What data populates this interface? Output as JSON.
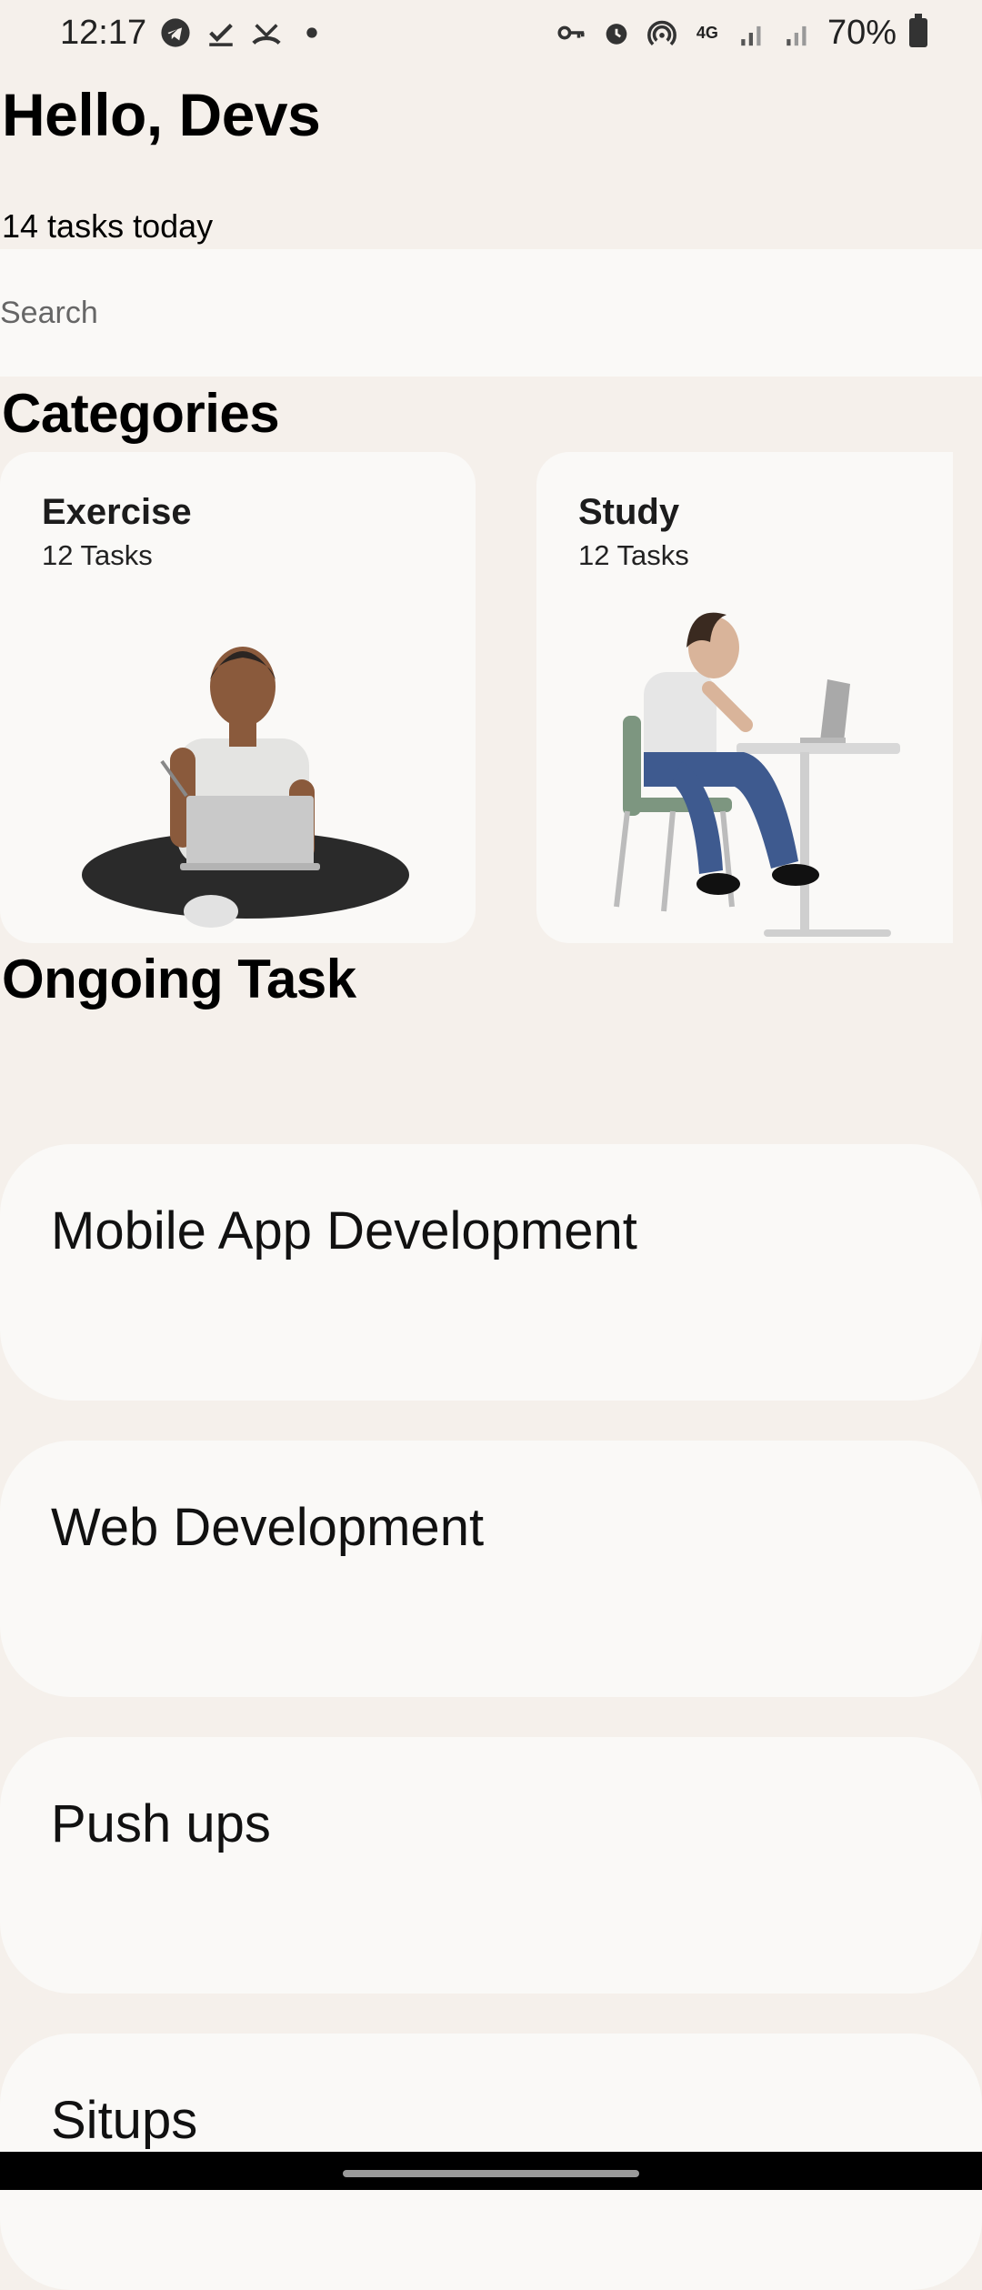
{
  "status_bar": {
    "time": "12:17",
    "battery": "70%",
    "network": "4G",
    "left_icons": [
      "telegram-icon",
      "check-icon",
      "missed-call-icon",
      "dot-icon"
    ],
    "right_icons": [
      "vpn-key-icon",
      "alarm-icon",
      "hotspot-icon",
      "network-4g-icon",
      "signal-icon",
      "signal-icon-2",
      "battery-icon"
    ]
  },
  "header": {
    "greeting": "Hello, Devs",
    "subtitle": "14 tasks today"
  },
  "search": {
    "placeholder": "Search"
  },
  "categories": {
    "title": "Categories",
    "items": [
      {
        "name": "Exercise",
        "count": "12 Tasks"
      },
      {
        "name": "Study",
        "count": "12 Tasks"
      }
    ]
  },
  "ongoing": {
    "title": "Ongoing Task",
    "tasks": [
      {
        "label": "Mobile App Development"
      },
      {
        "label": "Web Development"
      },
      {
        "label": "Push ups"
      },
      {
        "label": "Situps"
      }
    ]
  },
  "colors": {
    "background": "#f5f0eb",
    "card": "#faf9f7",
    "nav_bar": "#000000"
  }
}
